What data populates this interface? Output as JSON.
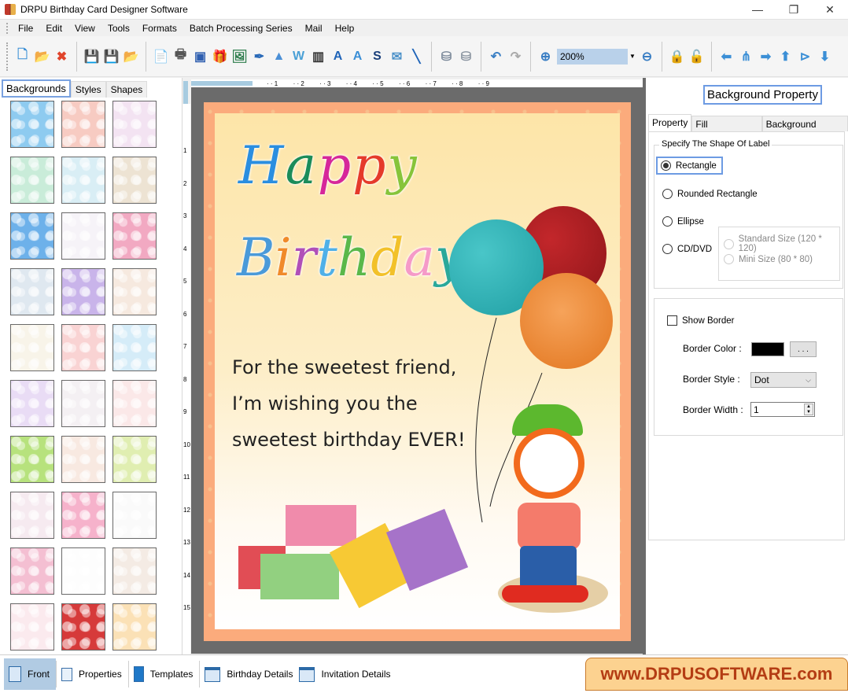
{
  "window": {
    "title": "DRPU Birthday Card Designer Software",
    "controls": [
      "minimize",
      "restore",
      "close"
    ],
    "control_glyphs": [
      "—",
      "❐",
      "✕"
    ]
  },
  "menu": [
    "File",
    "Edit",
    "View",
    "Tools",
    "Formats",
    "Batch Processing Series",
    "Mail",
    "Help"
  ],
  "toolbar": {
    "groups": [
      [
        {
          "name": "new-icon",
          "glyph": "🗋",
          "color": "#3b8fd6"
        },
        {
          "name": "open-icon",
          "glyph": "📂",
          "color": "#e8a93a"
        },
        {
          "name": "close-file-icon",
          "glyph": "✖",
          "color": "#e0442b"
        }
      ],
      [
        {
          "name": "save-icon",
          "glyph": "💾",
          "color": "#5a9bd5"
        },
        {
          "name": "save-as-icon",
          "glyph": "💾",
          "color": "#5a9bd5"
        },
        {
          "name": "export-icon",
          "glyph": "📂",
          "color": "#e8a93a"
        }
      ],
      [
        {
          "name": "properties-icon",
          "glyph": "📄",
          "color": "#3b7fc4"
        },
        {
          "name": "print-icon",
          "glyph": "🖶",
          "color": "#555"
        },
        {
          "name": "layers-icon",
          "glyph": "▣",
          "color": "#2f5fb0"
        },
        {
          "name": "gift-icon",
          "glyph": "🎁",
          "color": "#d86aa8"
        },
        {
          "name": "insert-image-icon",
          "glyph": "🖼",
          "color": "#2e7d4d"
        },
        {
          "name": "pencil-icon",
          "glyph": "✒",
          "color": "#2a6ab8"
        },
        {
          "name": "shapes-icon",
          "glyph": "▲",
          "color": "#4a8fd6"
        },
        {
          "name": "watermark-icon",
          "glyph": "W",
          "color": "#4aa0d6"
        },
        {
          "name": "barcode-icon",
          "glyph": "▥",
          "color": "#333"
        },
        {
          "name": "text-icon",
          "glyph": "A",
          "color": "#1f64b8"
        },
        {
          "name": "text-file-icon",
          "glyph": "A",
          "color": "#3b8fd6"
        },
        {
          "name": "signature-icon",
          "glyph": "S",
          "color": "#1a3f7a"
        },
        {
          "name": "mail-icon",
          "glyph": "✉",
          "color": "#4a90c8"
        },
        {
          "name": "line-icon",
          "glyph": "╲",
          "color": "#1f64b8"
        }
      ],
      [
        {
          "name": "database-icon",
          "glyph": "⛁",
          "color": "#7a8899"
        },
        {
          "name": "database-alt-icon",
          "glyph": "⛁",
          "color": "#8a94a0"
        }
      ],
      [
        {
          "name": "undo-icon",
          "glyph": "↶",
          "color": "#3b7fc4"
        },
        {
          "name": "redo-icon",
          "glyph": "↷",
          "color": "#aaa"
        }
      ],
      [
        {
          "name": "zoom-in-icon",
          "glyph": "⊕",
          "color": "#3b7fc4"
        }
      ]
    ],
    "zoom_value": "200%",
    "after_zoom": [
      {
        "name": "zoom-out-icon",
        "glyph": "⊖",
        "color": "#3b7fc4"
      }
    ],
    "locks": [
      {
        "name": "lock-icon",
        "glyph": "🔒",
        "color": "#e8a020"
      },
      {
        "name": "unlock-icon",
        "glyph": "🔓",
        "color": "#e8a020"
      }
    ],
    "arrange": [
      {
        "name": "arrow-left-icon",
        "glyph": "⬅",
        "color": "#3b8fd6"
      },
      {
        "name": "flip-horizontal-icon",
        "glyph": "⋔",
        "color": "#3b8fd6"
      },
      {
        "name": "arrow-right-icon",
        "glyph": "➡",
        "color": "#3b8fd6"
      },
      {
        "name": "arrow-up-icon",
        "glyph": "⬆",
        "color": "#3b8fd6"
      },
      {
        "name": "flip-vertical-icon",
        "glyph": "⊳",
        "color": "#3b8fd6"
      },
      {
        "name": "arrow-down-icon",
        "glyph": "⬇",
        "color": "#3b8fd6"
      }
    ]
  },
  "left_panel": {
    "tabs": [
      "Backgrounds",
      "Styles",
      "Shapes"
    ],
    "active_tab": "Backgrounds",
    "thumbnails": [
      {
        "name": "clouds",
        "bg": "#8ecbf0"
      },
      {
        "name": "pink-floral",
        "bg": "#f7cbc2"
      },
      {
        "name": "butterflies",
        "bg": "#f3e3f2"
      },
      {
        "name": "daisies",
        "bg": "#c9ecd9"
      },
      {
        "name": "winter-scene",
        "bg": "#d9eef5"
      },
      {
        "name": "bird-balloons",
        "bg": "#ede3d3"
      },
      {
        "name": "stars",
        "bg": "#6db1ea"
      },
      {
        "name": "pastel-balloons",
        "bg": "#f6f3f8"
      },
      {
        "name": "pink-birthday",
        "bg": "#f2a9c2"
      },
      {
        "name": "bubbles",
        "bg": "#dfe8f0"
      },
      {
        "name": "rainbow",
        "bg": "#c9b4ea"
      },
      {
        "name": "teddy",
        "bg": "#f6e9df"
      },
      {
        "name": "happy-birthday-text",
        "bg": "#f8f4e9"
      },
      {
        "name": "pink-hearts-stripes",
        "bg": "#f9d3d3"
      },
      {
        "name": "colorful-balloons",
        "bg": "#d5ecf8"
      },
      {
        "name": "heart-outlines",
        "bg": "#e9dcf5"
      },
      {
        "name": "balloon-bunches",
        "bg": "#f4f0f3"
      },
      {
        "name": "red-hearts",
        "bg": "#fbe8e8"
      },
      {
        "name": "green-stripes",
        "bg": "#b7e27d"
      },
      {
        "name": "cakes-sketch",
        "bg": "#f8e9e1"
      },
      {
        "name": "confetti-meadow",
        "bg": "#e0eeb1"
      },
      {
        "name": "tulips",
        "bg": "#f6eaf0"
      },
      {
        "name": "pink-hearts",
        "bg": "#f6b2cb"
      },
      {
        "name": "gift-sketch",
        "bg": "#fafafa"
      },
      {
        "name": "pink-texture",
        "bg": "#f4bfd2"
      },
      {
        "name": "sprinkles",
        "bg": "#fdfdfd"
      },
      {
        "name": "violet-flowers",
        "bg": "#f4ebe4"
      },
      {
        "name": "cupcakes",
        "bg": "#fbeaee"
      },
      {
        "name": "3d-hearts",
        "bg": "#d63a3a"
      },
      {
        "name": "party-banner",
        "bg": "#fbe1b6"
      }
    ]
  },
  "rulers": {
    "horizontal": [
      "1",
      "2",
      "3",
      "4",
      "5",
      "6",
      "7",
      "8",
      "9"
    ],
    "vertical": [
      "1",
      "2",
      "3",
      "4",
      "5",
      "6",
      "7",
      "8",
      "9",
      "10",
      "11",
      "12",
      "13",
      "14",
      "15"
    ]
  },
  "card": {
    "happy": [
      {
        "ch": "H",
        "color": "#2a8ee0"
      },
      {
        "ch": "a",
        "color": "#1b8c5a"
      },
      {
        "ch": "p",
        "color": "#d6279a"
      },
      {
        "ch": "p",
        "color": "#e53a2a"
      },
      {
        "ch": "y",
        "color": "#86c43a"
      }
    ],
    "birthday": [
      {
        "ch": "B",
        "color": "#4a9ad9"
      },
      {
        "ch": "i",
        "color": "#f08a2a"
      },
      {
        "ch": "r",
        "color": "#b04fb8"
      },
      {
        "ch": "t",
        "color": "#4fb0e8"
      },
      {
        "ch": "h",
        "color": "#5ab84a"
      },
      {
        "ch": "d",
        "color": "#f2c12a"
      },
      {
        "ch": "a",
        "color": "#f59ac8"
      },
      {
        "ch": "y",
        "color": "#2aa89a"
      }
    ],
    "message": [
      "For the sweetest friend,",
      "I’m wishing you the",
      "sweetest birthday EVER!"
    ]
  },
  "right_panel": {
    "header": "Background Property",
    "tabs": [
      "Property",
      "Fill Background",
      "Background Effects"
    ],
    "active_tab": "Property",
    "shape_group_label": "Specify The Shape Of Label",
    "shapes": [
      {
        "label": "Rectangle",
        "checked": true
      },
      {
        "label": "Rounded Rectangle",
        "checked": false
      },
      {
        "label": "Ellipse",
        "checked": false
      },
      {
        "label": "CD/DVD",
        "checked": false
      }
    ],
    "cd_sizes": [
      "Standard Size (120 * 120)",
      "Mini Size (80 * 80)"
    ],
    "show_border_label": "Show Border",
    "show_border_checked": false,
    "border_color_label": "Border Color :",
    "border_color": "#000000",
    "border_color_button": ". . .",
    "border_style_label": "Border Style :",
    "border_style_value": "Dot",
    "border_width_label": "Border Width :",
    "border_width_value": "1"
  },
  "bottom_tabs": [
    {
      "label": "Front",
      "icon": "front-page-icon",
      "active": true
    },
    {
      "label": "Properties",
      "icon": "properties-icon",
      "active": false
    },
    {
      "label": "Templates",
      "icon": "templates-icon",
      "active": false
    },
    {
      "label": "Birthday Details",
      "icon": "birthday-details-icon",
      "active": false
    },
    {
      "label": "Invitation Details",
      "icon": "invitation-details-icon",
      "active": false
    }
  ],
  "banner": {
    "text": "www.DRPUSOFTWARE.com"
  }
}
